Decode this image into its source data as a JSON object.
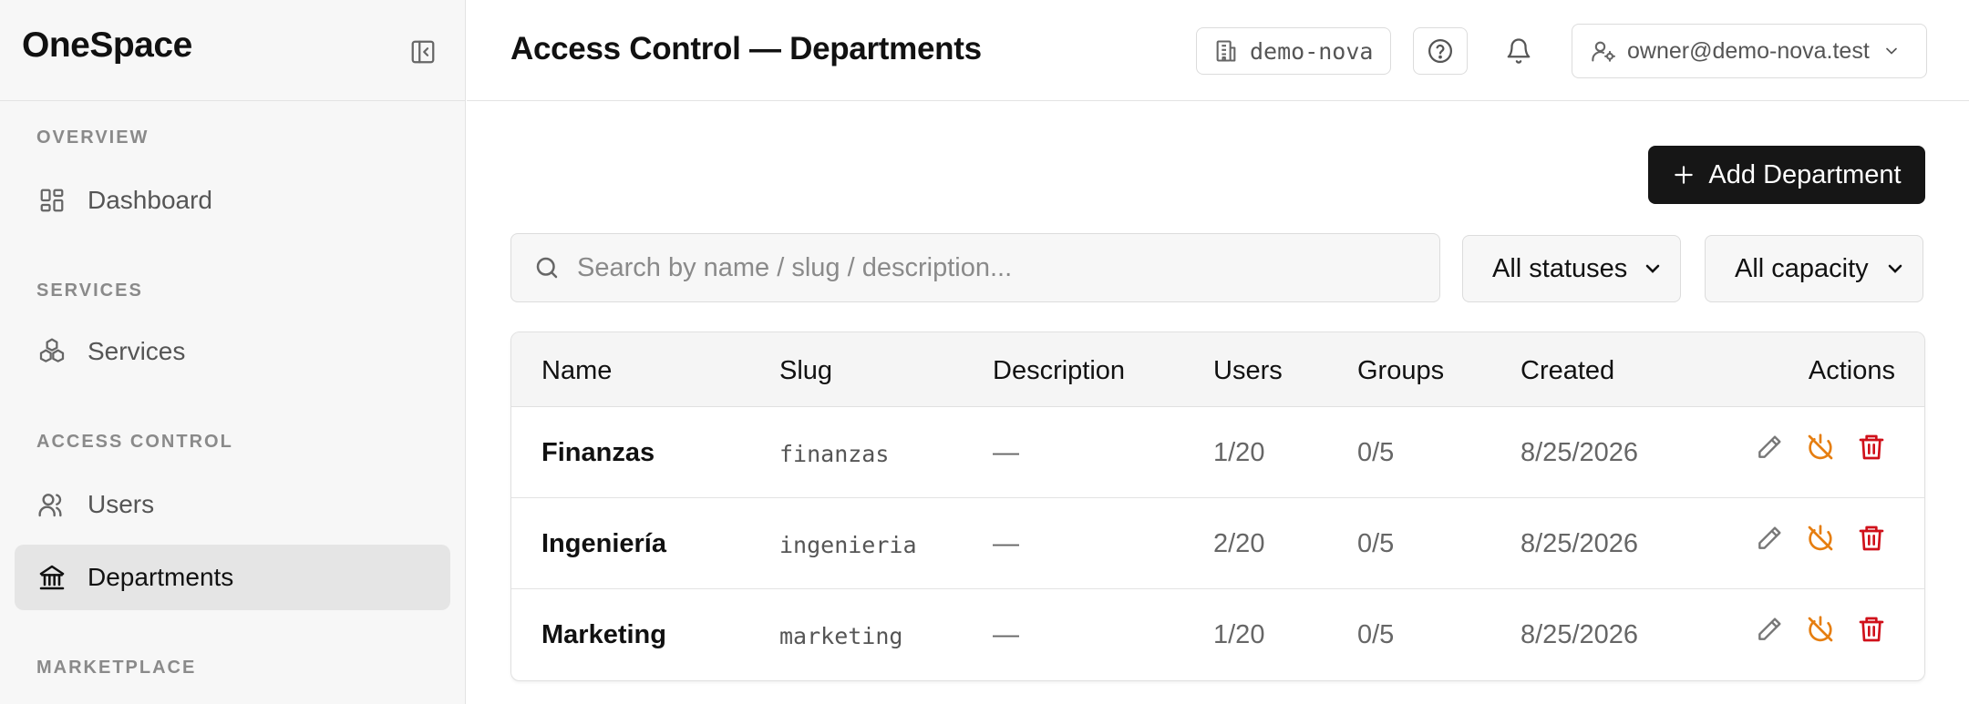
{
  "sidebar": {
    "brand": "OneSpace",
    "sections": [
      {
        "title": "OVERVIEW",
        "items": [
          {
            "label": "Dashboard",
            "icon": "dashboard-icon"
          }
        ]
      },
      {
        "title": "SERVICES",
        "items": [
          {
            "label": "Services",
            "icon": "boxes-icon"
          }
        ]
      },
      {
        "title": "ACCESS CONTROL",
        "items": [
          {
            "label": "Users",
            "icon": "users-icon"
          },
          {
            "label": "Departments",
            "icon": "building-columns-icon",
            "active": true
          }
        ]
      },
      {
        "title": "MARKETPLACE",
        "items": []
      }
    ]
  },
  "header": {
    "title": "Access Control — Departments",
    "tenant": "demo-nova",
    "user": "owner@demo-nova.test"
  },
  "toolbar": {
    "add_label": "Add Department",
    "search_placeholder": "Search by name / slug / description...",
    "status_filter": "All statuses",
    "capacity_filter": "All capacity"
  },
  "table": {
    "columns": [
      "Name",
      "Slug",
      "Description",
      "Users",
      "Groups",
      "Created",
      "Actions"
    ],
    "rows": [
      {
        "name": "Finanzas",
        "slug": "finanzas",
        "description": "—",
        "users": "1/20",
        "groups": "0/5",
        "created": "8/25/2026"
      },
      {
        "name": "Ingeniería",
        "slug": "ingenieria",
        "description": "—",
        "users": "2/20",
        "groups": "0/5",
        "created": "8/25/2026"
      },
      {
        "name": "Marketing",
        "slug": "marketing",
        "description": "—",
        "users": "1/20",
        "groups": "0/5",
        "created": "8/25/2026"
      }
    ]
  },
  "colors": {
    "accent_dark": "#161616",
    "warning": "#e67e10",
    "danger": "#d0101a",
    "active_nav_bg": "#e5e5e5"
  }
}
